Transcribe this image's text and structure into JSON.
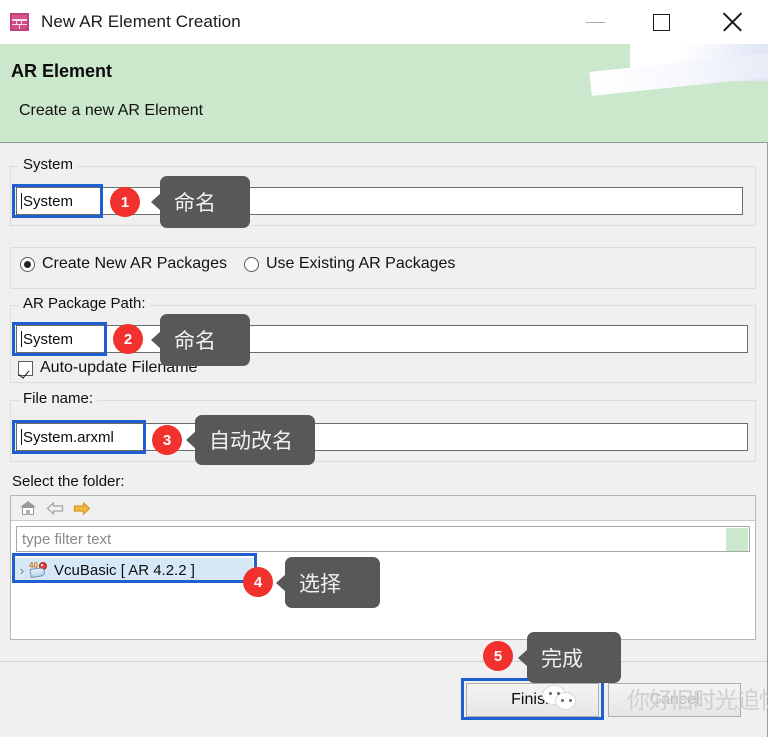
{
  "window": {
    "title": "New AR Element Creation",
    "icon": "ar-element-icon",
    "minimize_label": "Minimize",
    "maximize_label": "Maximize",
    "close_label": "Close"
  },
  "banner": {
    "title": "AR Element",
    "subtitle": "Create a new AR Element",
    "background_color": "#cce8cc"
  },
  "system_group": {
    "legend": "System",
    "input_value": "System"
  },
  "package_mode": {
    "options": [
      {
        "label": "Create New AR Packages",
        "selected": true
      },
      {
        "label": "Use Existing AR Packages",
        "selected": false
      }
    ]
  },
  "ar_package_path": {
    "legend": "AR Package Path:",
    "input_value": "System",
    "auto_update_label": "Auto-update Filename",
    "auto_update_checked": true
  },
  "file_name": {
    "legend": "File name:",
    "input_value": "System.arxml"
  },
  "folder_select": {
    "label": "Select the folder:",
    "toolbar": [
      {
        "icon": "home-icon",
        "enabled": true
      },
      {
        "icon": "arrow-left-icon",
        "enabled": false
      },
      {
        "icon": "arrow-right-icon",
        "enabled": true
      }
    ],
    "filter_placeholder": "type filter text",
    "filter_value": "",
    "tree": [
      {
        "label": "VcuBasic [ AR 4.2.2 ]",
        "icon": "autosar-project-icon",
        "expander": "›",
        "selected": true
      }
    ]
  },
  "footer": {
    "finish_label": "Finish",
    "cancel_label": "Cancel"
  },
  "watermark": {
    "logo": "wechat-logo-icon",
    "text": "你好旧时光追忆"
  },
  "annotations": {
    "accent_color": "#f0312d",
    "tooltip_color": "#585858",
    "highlight_color": "#1f5fd0",
    "items": [
      {
        "number": "1",
        "tip": "命名"
      },
      {
        "number": "2",
        "tip": "命名"
      },
      {
        "number": "3",
        "tip": "自动改名"
      },
      {
        "number": "4",
        "tip": "选择"
      },
      {
        "number": "5",
        "tip": "完成"
      }
    ]
  }
}
